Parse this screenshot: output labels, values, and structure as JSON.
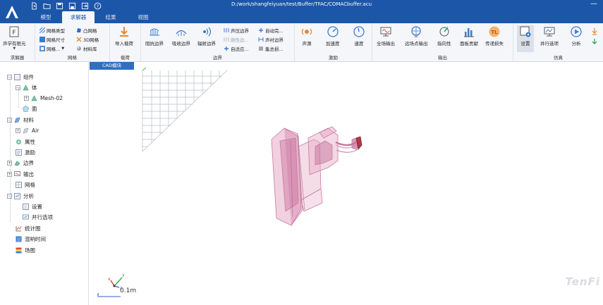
{
  "window": {
    "title": "D:/work/shangfeiyuan/test/Buffer/TFAC/COMACbuffer.acu",
    "minimize_glyph": "—"
  },
  "quick_access": [
    "new-file-icon",
    "open-folder-icon",
    "save-icon",
    "save-as-icon",
    "export-icon",
    "help-icon"
  ],
  "menu": {
    "tabs": [
      "模型",
      "求解器",
      "结果",
      "视图"
    ],
    "active": "求解器"
  },
  "ribbon": {
    "solver_group": {
      "label": "求解器",
      "solver_button": "声学有限元",
      "dropdown_glyph": "▼"
    },
    "mesh_group": {
      "label": "网格",
      "items": [
        "网格类型",
        "网格尺寸",
        "网格...",
        "凸网格",
        "3D网格",
        "材料库"
      ],
      "dropdown_glyph": "▼"
    },
    "load_group": {
      "label": "载荷",
      "import_load": "导入载荷"
    },
    "boundary_group": {
      "label": "边界",
      "big": [
        "阻抗边界",
        "吸收边界",
        "辐射边界"
      ],
      "small": [
        "声压边界",
        "自动完...",
        "刚性边...",
        "声衬边界",
        "自适应...",
        "集总损..."
      ]
    },
    "excitation_group": {
      "label": "激励",
      "items": [
        "声源",
        "加速度",
        "速度"
      ]
    },
    "output_group": {
      "label": "输出",
      "items": [
        "全场输出",
        "远场点输出",
        "指向性",
        "面板贡献",
        "传递损失"
      ]
    },
    "simulation_group": {
      "label": "仿真",
      "items": [
        "设置",
        "并行选项",
        "分析"
      ]
    }
  },
  "tree": [
    {
      "label": "组件",
      "expander": "⊟"
    },
    {
      "label": "体",
      "expander": "⊟"
    },
    {
      "label": "Mesh-02",
      "expander": "⊞"
    },
    {
      "label": "面"
    },
    {
      "label": "材料",
      "expander": "⊟"
    },
    {
      "label": "Air",
      "expander": "⊞"
    },
    {
      "label": "属性"
    },
    {
      "label": "激励"
    },
    {
      "label": "边界",
      "expander": "⊞"
    },
    {
      "label": "输出",
      "expander": "⊞"
    },
    {
      "label": "网格"
    },
    {
      "label": "分析",
      "expander": "⊟"
    },
    {
      "label": "设置"
    },
    {
      "label": "并行选项"
    },
    {
      "label": "统计图"
    },
    {
      "label": "混响时间"
    },
    {
      "label": "场图"
    }
  ],
  "viewport": {
    "tab_label": "CAD模块",
    "scale_label": "0.1m",
    "watermark": "TenFi",
    "axis_labels": [
      "x",
      "y",
      "z"
    ]
  },
  "colors": {
    "titlebar": "#1c56a8",
    "ribbon_bg": "#f4f6fa",
    "model_fill": "#e6aac6",
    "model_edge": "#c97aa0",
    "accent_orange": "#e6892b"
  }
}
